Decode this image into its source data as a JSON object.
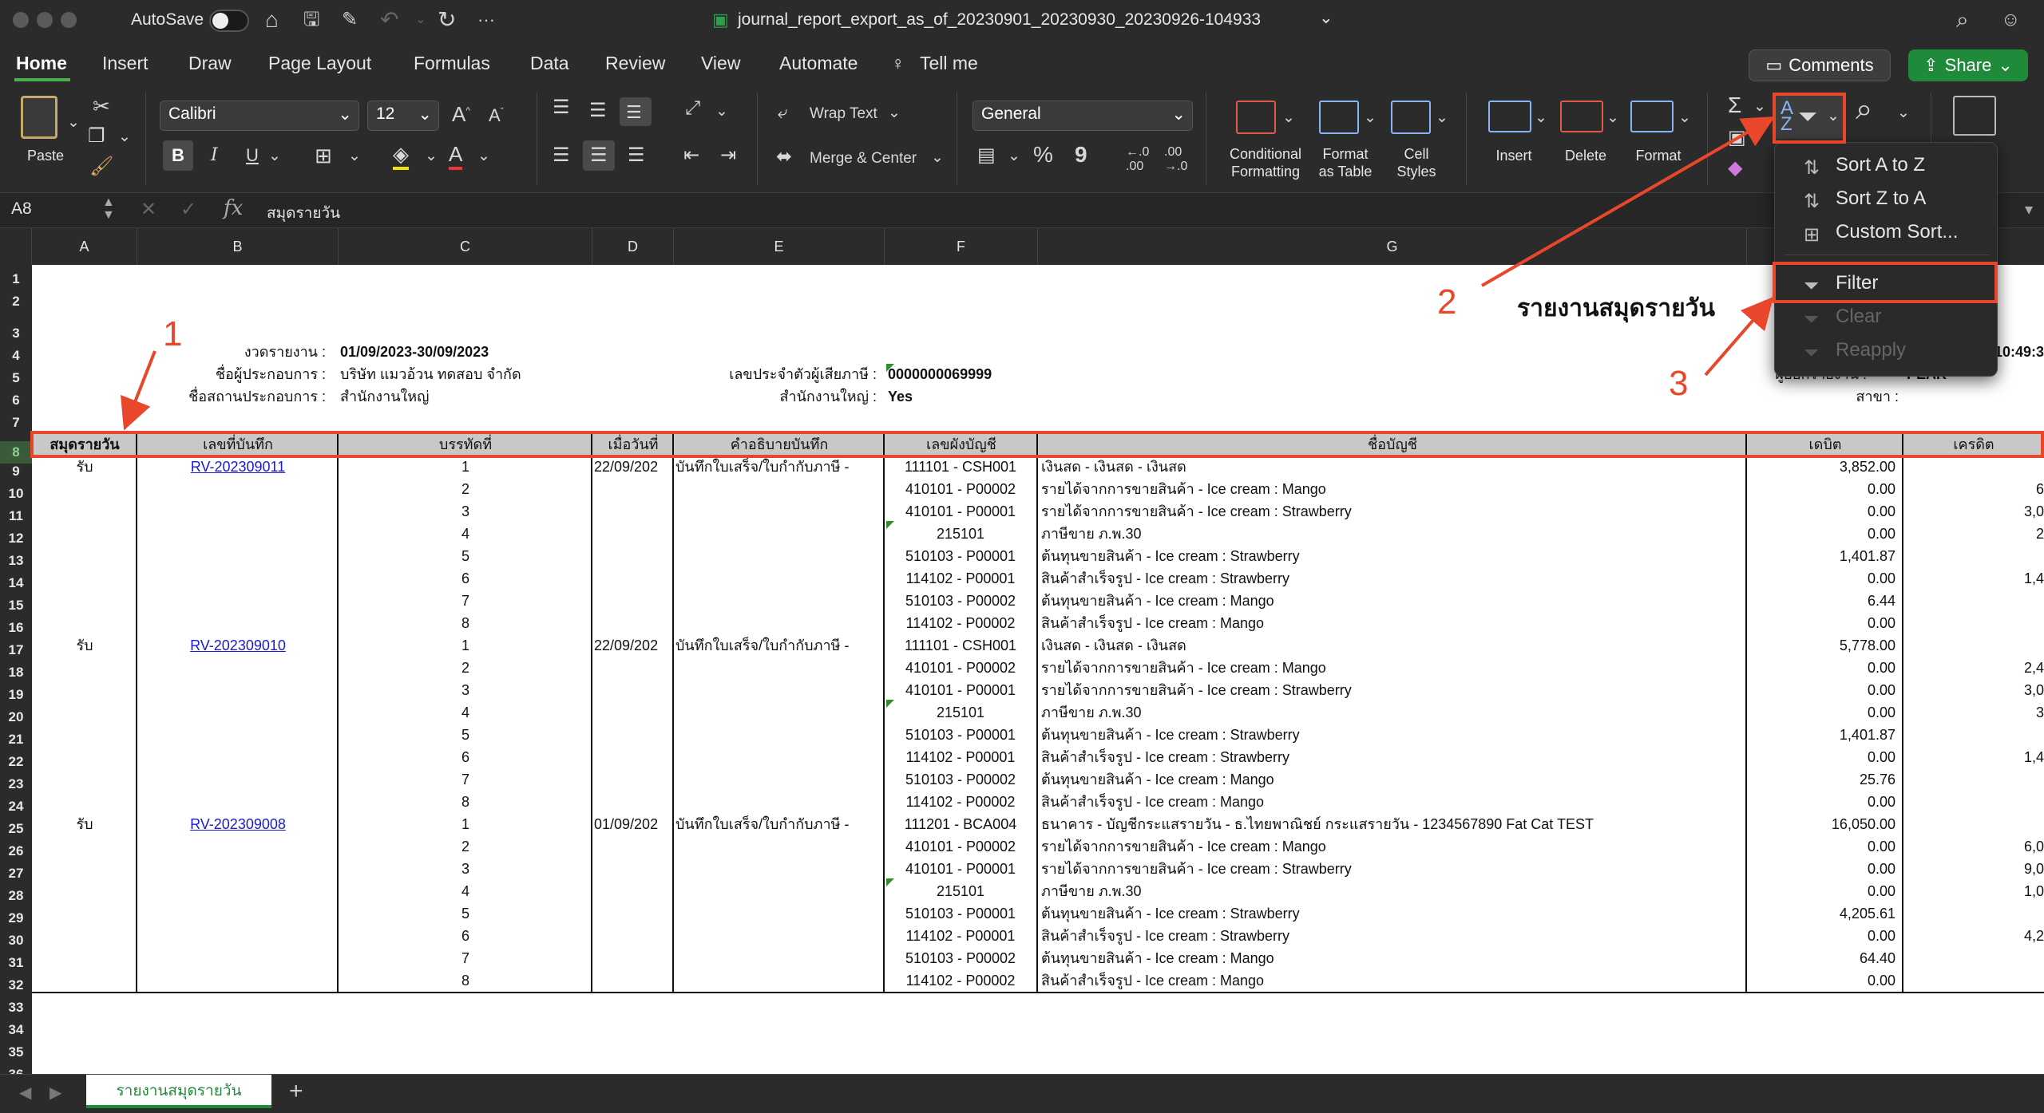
{
  "window": {
    "autosave_label": "AutoSave",
    "file_title": "journal_report_export_as_of_20230901_20230930_20230926-104933",
    "title_chevron": "⌄",
    "more": "···"
  },
  "menu": {
    "items": [
      "Home",
      "Insert",
      "Draw",
      "Page Layout",
      "Formulas",
      "Data",
      "Review",
      "View",
      "Automate",
      "Tell me"
    ],
    "comments": "Comments",
    "share": "Share"
  },
  "ribbon": {
    "paste": "Paste",
    "font_name": "Calibri",
    "font_size": "12",
    "bold": "B",
    "italic": "I",
    "underline": "U",
    "wrap_text": "Wrap Text",
    "merge_center": "Merge & Center",
    "number_format": "General",
    "conditional_formatting_1": "Conditional",
    "conditional_formatting_2": "Formatting",
    "format_as_table_1": "Format",
    "format_as_table_2": "as Table",
    "cell_styles_1": "Cell",
    "cell_styles_2": "Styles",
    "insert": "Insert",
    "delete": "Delete",
    "format": "Format",
    "percent": "%",
    "comma": "9"
  },
  "formula_bar": {
    "name_box": "A8",
    "fx": "fx",
    "value": "สมุดรายวัน"
  },
  "columns": [
    "A",
    "B",
    "C",
    "D",
    "E",
    "F",
    "G"
  ],
  "rows": [
    "1",
    "2",
    "3",
    "4",
    "5",
    "6",
    "7",
    "8",
    "9",
    "10",
    "11",
    "12",
    "13",
    "14",
    "15",
    "16",
    "17",
    "18",
    "19",
    "20",
    "21",
    "22",
    "23",
    "24",
    "25",
    "26",
    "27",
    "28",
    "29",
    "30",
    "31",
    "32",
    "33",
    "34",
    "35",
    "36"
  ],
  "report": {
    "title": "รายงานสมุดรายวัน",
    "period_label": "งวดรายงาน :",
    "period_value": "01/09/2023-30/09/2023",
    "company_label": "ชื่อผู้ประกอบการ :",
    "company_value": "บริษัท แมวอ้วน ทดสอบ จำกัด",
    "branch_label": "ชื่อสถานประกอบการ :",
    "branch_value": "สำนักงานใหญ่",
    "taxid_label": "เลขประจำตัวผู้เสียภาษี :",
    "taxid_value": "0000000069999",
    "hq_label": "สำนักงานใหญ่ :",
    "hq_value": "Yes",
    "time_partial": "10:49:3",
    "preparer_label": "ผู้ออกรายงาน :",
    "preparer_value": "PEAK",
    "branch2_label": "สาขา :"
  },
  "table_header": [
    "สมุดรายวัน",
    "เลขที่บันทึก",
    "บรรทัดที่",
    "เมื่อวันที่",
    "คำอธิบายบันทึก",
    "เลขผังบัญชี",
    "ชื่อบัญชี",
    "เดบิต",
    "เครดิต"
  ],
  "entries": [
    {
      "journal": "รับ",
      "doc": "RV-202309011",
      "date": "22/09/202",
      "desc": "บันทึกใบเสร็จ/ใบกำกับภาษี -",
      "lines": [
        [
          "1",
          "111101 - CSH001",
          "เงินสด - เงินสด - เงินสด",
          "3,852.00",
          ""
        ],
        [
          "2",
          "410101 - P00002",
          "รายได้จากการขายสินค้า -  Ice cream : Mango",
          "0.00",
          "6"
        ],
        [
          "3",
          "410101 - P00001",
          "รายได้จากการขายสินค้า - Ice cream : Strawberry",
          "0.00",
          "3,0"
        ],
        [
          "4",
          "215101",
          "ภาษีขาย ภ.พ.30",
          "0.00",
          "2"
        ],
        [
          "5",
          "510103 - P00001",
          "ต้นทุนขายสินค้า - Ice cream : Strawberry",
          "1,401.87",
          ""
        ],
        [
          "6",
          "114102 - P00001",
          "สินค้าสำเร็จรูป - Ice cream : Strawberry",
          "0.00",
          "1,4"
        ],
        [
          "7",
          "510103 - P00002",
          "ต้นทุนขายสินค้า -  Ice cream : Mango",
          "6.44",
          ""
        ],
        [
          "8",
          "114102 - P00002",
          "สินค้าสำเร็จรูป -  Ice cream : Mango",
          "0.00",
          ""
        ]
      ]
    },
    {
      "journal": "รับ",
      "doc": "RV-202309010",
      "date": "22/09/202",
      "desc": "บันทึกใบเสร็จ/ใบกำกับภาษี -",
      "lines": [
        [
          "1",
          "111101 - CSH001",
          "เงินสด - เงินสด - เงินสด",
          "5,778.00",
          ""
        ],
        [
          "2",
          "410101 - P00002",
          "รายได้จากการขายสินค้า -  Ice cream : Mango",
          "0.00",
          "2,4"
        ],
        [
          "3",
          "410101 - P00001",
          "รายได้จากการขายสินค้า - Ice cream : Strawberry",
          "0.00",
          "3,0"
        ],
        [
          "4",
          "215101",
          "ภาษีขาย ภ.พ.30",
          "0.00",
          "3"
        ],
        [
          "5",
          "510103 - P00001",
          "ต้นทุนขายสินค้า - Ice cream : Strawberry",
          "1,401.87",
          ""
        ],
        [
          "6",
          "114102 - P00001",
          "สินค้าสำเร็จรูป - Ice cream : Strawberry",
          "0.00",
          "1,4"
        ],
        [
          "7",
          "510103 - P00002",
          "ต้นทุนขายสินค้า -  Ice cream : Mango",
          "25.76",
          ""
        ],
        [
          "8",
          "114102 - P00002",
          "สินค้าสำเร็จรูป -  Ice cream : Mango",
          "0.00",
          ""
        ]
      ]
    },
    {
      "journal": "รับ",
      "doc": "RV-202309008",
      "date": "01/09/202",
      "desc": "บันทึกใบเสร็จ/ใบกำกับภาษี -",
      "lines": [
        [
          "1",
          "111201 - BCA004",
          "ธนาคาร - บัญชีกระแสรายวัน - ธ.ไทยพาณิชย์ กระแสรายวัน - 1234567890 Fat Cat TEST",
          "16,050.00",
          ""
        ],
        [
          "2",
          "410101 - P00002",
          "รายได้จากการขายสินค้า -  Ice cream : Mango",
          "0.00",
          "6,0"
        ],
        [
          "3",
          "410101 - P00001",
          "รายได้จากการขายสินค้า - Ice cream : Strawberry",
          "0.00",
          "9,0"
        ],
        [
          "4",
          "215101",
          "ภาษีขาย ภ.พ.30",
          "0.00",
          "1,0"
        ],
        [
          "5",
          "510103 - P00001",
          "ต้นทุนขายสินค้า - Ice cream : Strawberry",
          "4,205.61",
          ""
        ],
        [
          "6",
          "114102 - P00001",
          "สินค้าสำเร็จรูป - Ice cream : Strawberry",
          "0.00",
          "4,2"
        ],
        [
          "7",
          "510103 - P00002",
          "ต้นทุนขายสินค้า -  Ice cream : Mango",
          "64.40",
          ""
        ],
        [
          "8",
          "114102 - P00002",
          "สินค้าสำเร็จรูป -  Ice cream : Mango",
          "0.00",
          ""
        ]
      ]
    }
  ],
  "sort_filter_menu": {
    "sort_az": "Sort A to Z",
    "sort_za": "Sort Z to A",
    "custom_sort": "Custom Sort...",
    "filter": "Filter",
    "clear": "Clear",
    "reapply": "Reapply"
  },
  "annotations": {
    "one": "1",
    "two": "2",
    "three": "3"
  },
  "sheet_tab": {
    "name": "รายงานสมุดรายวัน",
    "add": "+"
  },
  "colors": {
    "accent_green": "#1f8b3a",
    "annotation_red": "#e8472b",
    "link_blue": "#1a1ad6"
  }
}
